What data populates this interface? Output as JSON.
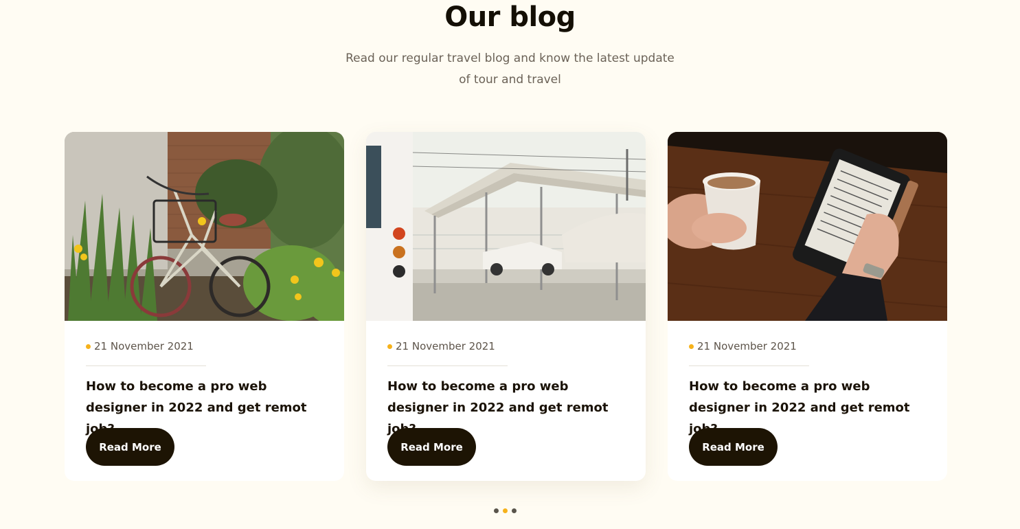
{
  "section": {
    "title": "Our blog",
    "subtitle_line1": "Read our regular travel blog and know the latest update",
    "subtitle_line2": "of tour and travel"
  },
  "cards": [
    {
      "image": "bicycle-garden-photo",
      "date": "21 November 2021",
      "title": "How to become a pro web designer in 2022 and get remot job?",
      "button_label": "Read More"
    },
    {
      "image": "rv-carport-photo",
      "date": "21 November 2021",
      "title": "How to become a pro web designer in 2022 and get remot job?",
      "button_label": "Read More"
    },
    {
      "image": "coffee-ereader-photo",
      "date": "21 November 2021",
      "title": "How to become a pro web designer in 2022 and get remot job?",
      "button_label": "Read More"
    }
  ],
  "pagination": {
    "count": 3,
    "active_index": 1
  },
  "colors": {
    "background": "#fffcf3",
    "accent": "#f6b21b",
    "button": "#1d1404",
    "heading": "#140f05"
  }
}
